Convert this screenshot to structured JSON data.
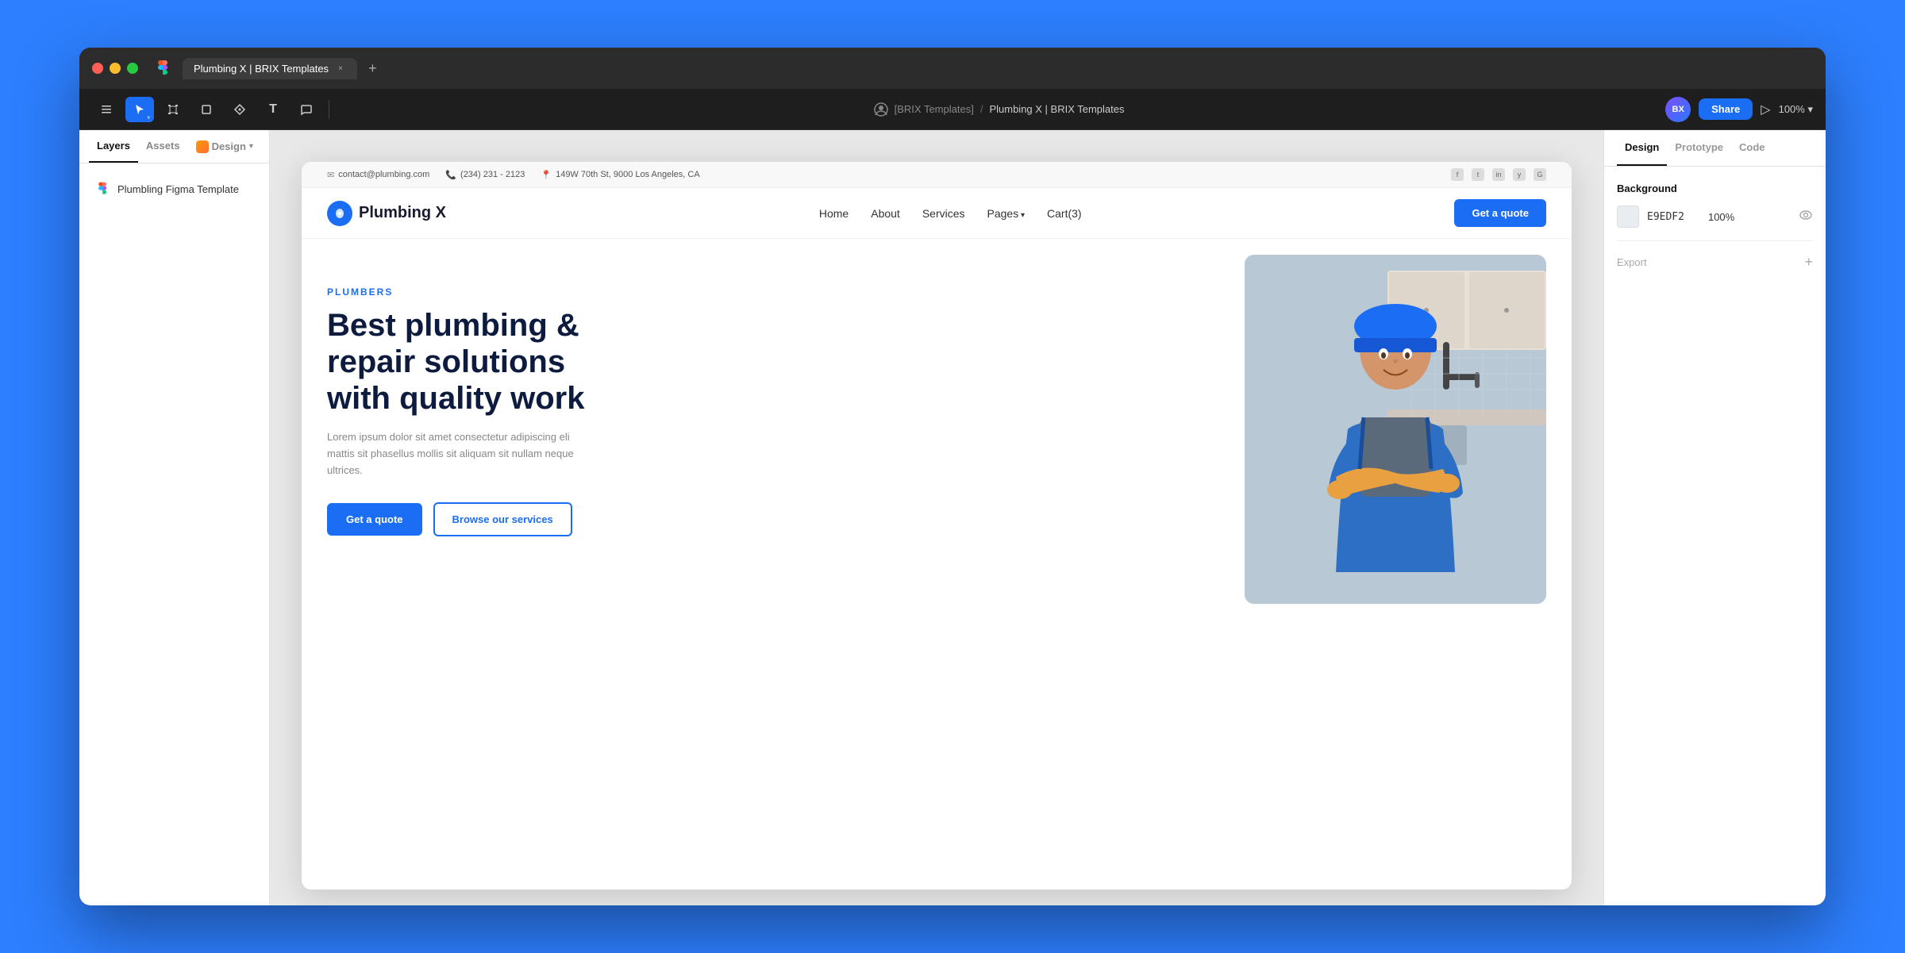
{
  "browser": {
    "tab_title": "Plumbing X | BRIX Templates",
    "tab_close": "×",
    "tab_new": "+",
    "figma_icon": "F"
  },
  "figma_toolbar": {
    "menu_icon": "☰",
    "cursor_tool": "↖",
    "frame_tool": "#",
    "shape_tool": "□",
    "pen_tool": "✒",
    "text_tool": "T",
    "comment_tool": "💬",
    "breadcrumb_separator": "/",
    "user_org": "[BRIX Templates]",
    "project_name": "Plumbing X | BRIX Templates",
    "share_label": "Share",
    "play_icon": "▷",
    "zoom_level": "100%",
    "zoom_arrow": "▾"
  },
  "left_panel": {
    "tab_layers": "Layers",
    "tab_assets": "Assets",
    "tab_design": "Design",
    "design_arrow": "▾",
    "layer_name": "Plumbling Figma Template"
  },
  "canvas": {
    "background_color": "#e8e8e8"
  },
  "website": {
    "topbar": {
      "email_icon": "✉",
      "email": "contact@plumbing.com",
      "phone_icon": "📞",
      "phone": "(234) 231 - 2123",
      "location_icon": "📍",
      "address": "149W 70th St, 9000 Los Angeles, CA",
      "social_icons": [
        "f",
        "t",
        "in",
        "y",
        "g"
      ]
    },
    "nav": {
      "logo_text": "Plumbing X",
      "nav_home": "Home",
      "nav_about": "About",
      "nav_services": "Services",
      "nav_pages": "Pages",
      "nav_cart": "Cart(3)",
      "cta_button": "Get a quote"
    },
    "hero": {
      "label": "PLUMBERS",
      "title_line1": "Best plumbing &",
      "title_line2": "repair solutions",
      "title_line3": "with quality work",
      "subtitle": "Lorem ipsum dolor sit amet consectetur adipiscing eli mattis sit phasellus mollis sit aliquam sit nullam neque ultrices.",
      "btn_primary": "Get a quote",
      "btn_outline": "Browse our services"
    }
  },
  "right_panel": {
    "tab_design": "Design",
    "tab_prototype": "Prototype",
    "tab_code": "Code",
    "background_section_title": "Background",
    "bg_color": "E9EDF2",
    "bg_opacity": "100%",
    "export_label": "Export",
    "export_plus": "+"
  }
}
